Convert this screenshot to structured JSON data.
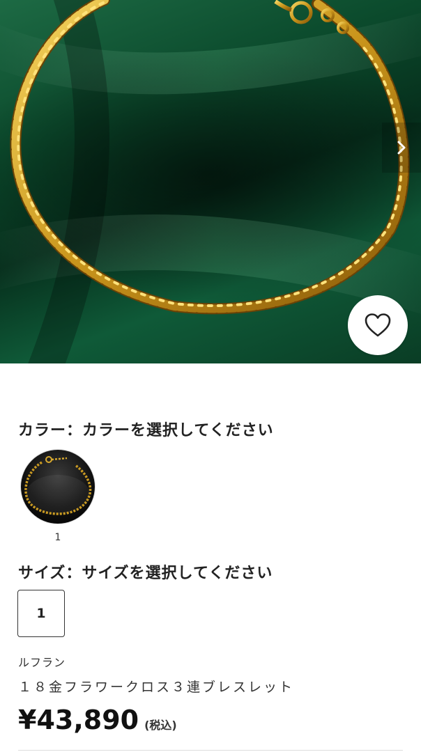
{
  "hero": {
    "next_icon": "chevron-right-icon",
    "favorite_icon": "heart-outline-icon"
  },
  "color_section": {
    "title": "カラー：カラーを選択してください",
    "options": [
      {
        "label": "1"
      }
    ]
  },
  "size_section": {
    "title": "サイズ：サイズを選択してください",
    "options": [
      {
        "label": "1"
      }
    ]
  },
  "product": {
    "brand": "ルフラン",
    "name": "１８金フラワークロス３連ブレスレット",
    "price": "¥43,890",
    "tax_note": "(税込)"
  },
  "colors": {
    "background_green": "#0b4a2c",
    "gold": "#d9a92a"
  }
}
